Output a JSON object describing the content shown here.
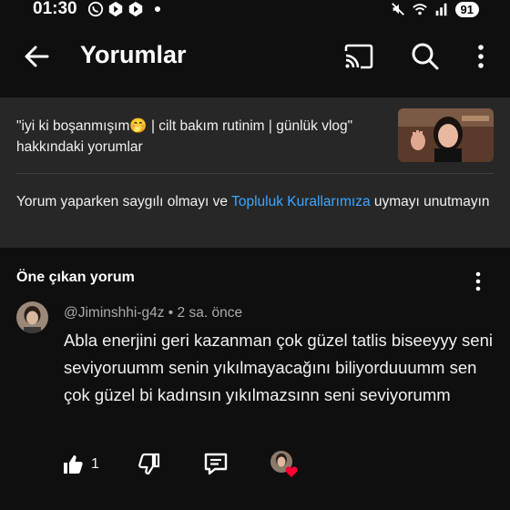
{
  "status_bar": {
    "time": "01:30",
    "battery": "91"
  },
  "app_bar": {
    "title": "Yorumlar"
  },
  "video": {
    "title": "\"iyi ki boşanmışım🤭 | cilt bakım rutinim | günlük vlog\" hakkındaki yorumlar"
  },
  "guidelines": {
    "before": "Yorum yaparken saygılı olmayı ve ",
    "link": "Topluluk Kurallarımıza",
    "after": " uymayı unutmayın"
  },
  "section": {
    "label": "Öne çıkan yorum"
  },
  "comment": {
    "author": "@Jiminshhi-g4z",
    "time": " • 2 sa. önce",
    "text": "Abla enerjini geri kazanman çok güzel tatlis biseeyyy seni seviyoruumm senin yıkılmayacağını biliyorduuumm sen çok güzel bi kadınsın yıkılmazsınn seni seviyorumm",
    "likes": "1"
  },
  "colors": {
    "background": "#0f0f0f",
    "card": "#272727",
    "link": "#3ea6ff",
    "heart": "#ff0033"
  },
  "icons": [
    "whatsapp-icon",
    "app-icon",
    "app-icon",
    "mute-icon",
    "wifi-icon",
    "signal-icon",
    "back-icon",
    "cast-icon",
    "search-icon",
    "more-icon",
    "like-icon",
    "dislike-icon",
    "reply-icon",
    "heart-icon"
  ]
}
